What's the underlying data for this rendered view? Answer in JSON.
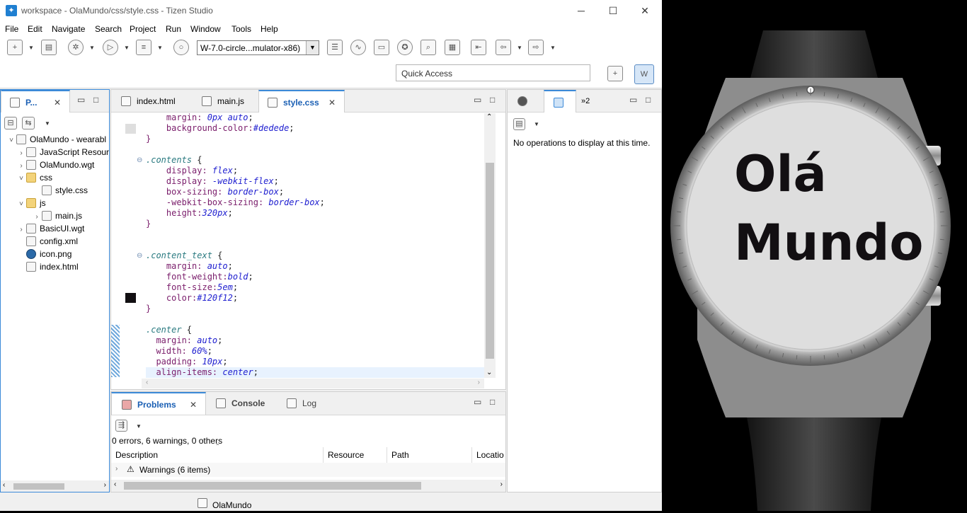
{
  "window": {
    "title": "workspace - OlaMundo/css/style.css - Tizen Studio",
    "min_glyph": "─",
    "max_glyph": "☐",
    "close_glyph": "✕"
  },
  "menu": [
    "File",
    "Edit",
    "Navigate",
    "Search",
    "Project",
    "Run",
    "Window",
    "Tools",
    "Help"
  ],
  "toolbar": {
    "target": "W-7.0-circle...mulator-x86)",
    "quick_access": "Quick Access"
  },
  "project_explorer": {
    "tab_label": "P...",
    "items": [
      {
        "label": "OlaMundo - wearabl",
        "twisty": "˅",
        "icon": "project-icon"
      },
      {
        "label": "JavaScript Resour",
        "twisty": "›",
        "icon": "library-icon"
      },
      {
        "label": "OlaMundo.wgt",
        "twisty": "›",
        "icon": "package-icon"
      },
      {
        "label": "css",
        "twisty": "˅",
        "icon": "folder-icon"
      },
      {
        "label": "style.css",
        "twisty": "",
        "icon": "css-file-icon"
      },
      {
        "label": "js",
        "twisty": "˅",
        "icon": "folder-icon"
      },
      {
        "label": "main.js",
        "twisty": "›",
        "icon": "js-file-icon"
      },
      {
        "label": "BasicUI.wgt",
        "twisty": "›",
        "icon": "package-icon"
      },
      {
        "label": "config.xml",
        "twisty": "",
        "icon": "xml-file-icon"
      },
      {
        "label": "icon.png",
        "twisty": "",
        "icon": "image-file-icon"
      },
      {
        "label": "index.html",
        "twisty": "",
        "icon": "html-file-icon"
      }
    ]
  },
  "editor": {
    "tabs": [
      "index.html",
      "main.js",
      "style.css"
    ],
    "active_tab": "style.css",
    "close_glyph": "✕"
  },
  "code_lines": [
    {
      "t": "    margin: ",
      "v": "0px auto",
      "e": ";"
    },
    {
      "t": "    background-color:",
      "v": "#dedede",
      "e": ";"
    },
    {
      "t": "}",
      "v": "",
      "e": ""
    },
    {
      "t": "",
      "v": "",
      "e": ""
    },
    {
      "t": ".contents",
      "v": "",
      "e": " {",
      "sel": true
    },
    {
      "t": "    display: ",
      "v": "flex",
      "e": ";"
    },
    {
      "t": "    display: ",
      "v": "-webkit-flex",
      "e": ";"
    },
    {
      "t": "    box-sizing: ",
      "v": "border-box",
      "e": ";"
    },
    {
      "t": "    -webkit-box-sizing: ",
      "v": "border-box",
      "e": ";"
    },
    {
      "t": "    height:",
      "v": "320px",
      "e": ";"
    },
    {
      "t": "}",
      "v": "",
      "e": ""
    },
    {
      "t": "",
      "v": "",
      "e": ""
    },
    {
      "t": "",
      "v": "",
      "e": ""
    },
    {
      "t": ".content_text",
      "v": "",
      "e": " {",
      "sel": true
    },
    {
      "t": "    margin: ",
      "v": "auto",
      "e": ";"
    },
    {
      "t": "    font-weight:",
      "v": "bold",
      "e": ";"
    },
    {
      "t": "    font-size:",
      "v": "5em",
      "e": ";"
    },
    {
      "t": "    color:",
      "v": "#120f12",
      "e": ";"
    },
    {
      "t": "}",
      "v": "",
      "e": ""
    },
    {
      "t": "",
      "v": "",
      "e": ""
    },
    {
      "t": ".center",
      "v": "",
      "e": " {",
      "sel": true
    },
    {
      "t": "  margin: ",
      "v": "auto",
      "e": ";"
    },
    {
      "t": "  width: ",
      "v": "60%",
      "e": ";"
    },
    {
      "t": "  padding: ",
      "v": "10px",
      "e": ";"
    },
    {
      "t": "  align-items: ",
      "v": "center",
      "e": ";",
      "hl": true
    }
  ],
  "right_panel": {
    "overflow_label": "»2",
    "message": "No operations to display at this time."
  },
  "bottom_panel": {
    "tabs": [
      "Problems",
      "Console",
      "Log"
    ],
    "active_tab": "Problems",
    "summary": "0 errors, 6 warnings, 0 others",
    "columns": [
      "Description",
      "Resource",
      "Path",
      "Locatio"
    ],
    "rows": [
      {
        "label": "Warnings (6 items)"
      }
    ]
  },
  "status": {
    "project": "OlaMundo"
  },
  "watch": {
    "line1": "Olá",
    "line2": "Mundo"
  },
  "colors": {
    "accent": "#3c8ad8",
    "swatch_bg": "#dedede",
    "swatch_text": "#120f12",
    "watch_face": "#dedede"
  }
}
